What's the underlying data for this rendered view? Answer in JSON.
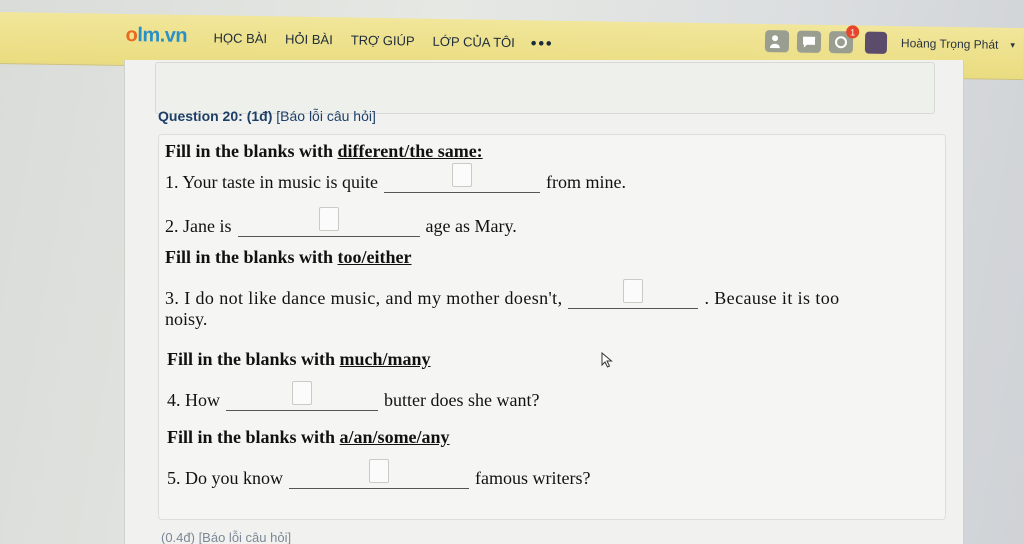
{
  "nav": {
    "logo_o": "o",
    "logo_rest": "lm.vn",
    "items": [
      "HỌC BÀI",
      "HỎI BÀI",
      "TRỢ GIÚP",
      "LỚP CỦA TÔI"
    ],
    "more": "•••",
    "notification_count": "1",
    "user_name": "Hoàng Trọng Phát",
    "caret": "▾"
  },
  "question": {
    "label": "Question 20:",
    "points": "(1đ)",
    "report": "[Báo lỗi câu hỏi]"
  },
  "sections": [
    {
      "instr_prefix": "Fill in the blanks with ",
      "instr_words": "different/the same:"
    },
    {
      "instr_prefix": "Fill in the blanks with ",
      "instr_words": "too/either"
    },
    {
      "instr_prefix": "Fill in the blanks with ",
      "instr_words": "much/many"
    },
    {
      "instr_prefix": "Fill in the blanks with ",
      "instr_words": "a/an/some/any"
    }
  ],
  "items": [
    {
      "before": "1. Your taste in music is quite",
      "after": "from mine."
    },
    {
      "before": "2. Jane is",
      "after": "age as Mary."
    },
    {
      "before": "3. I do not like dance music, and my mother doesn't,",
      "after": ". Because it is too",
      "wrap": "noisy."
    },
    {
      "before": "4. How",
      "after": "butter does she want?"
    },
    {
      "before": "5. Do you know",
      "after": "famous writers?"
    }
  ],
  "footer_text": "(0.4đ) [Báo lỗi câu hỏi]",
  "colors": {
    "nav_bg": "#ece07f",
    "logo_blue": "#2a8fc6",
    "logo_orange": "#e96a1e",
    "heading": "#1d3f67"
  }
}
